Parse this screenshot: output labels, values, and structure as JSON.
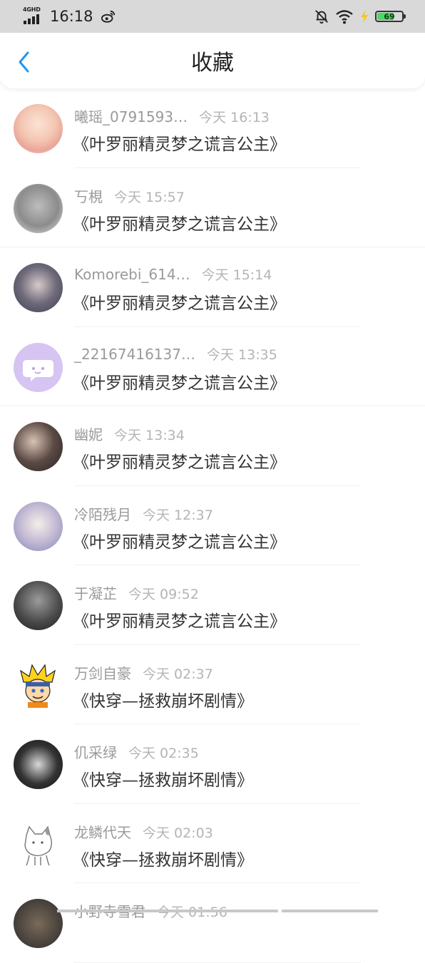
{
  "status_bar": {
    "network": "4GHD",
    "time": "16:18",
    "battery": "69",
    "battery_level": 0.69
  },
  "header": {
    "title": "收藏",
    "back_icon": "chevron-left-icon"
  },
  "items": [
    {
      "username": "曦瑶_0791593…",
      "time": "今天 16:13",
      "title": "《叶罗丽精灵梦之谎言公主》"
    },
    {
      "username": "丂梘",
      "time": "今天 15:57",
      "title": "《叶罗丽精灵梦之谎言公主》"
    },
    {
      "username": "Komorebi_614…",
      "time": "今天 15:14",
      "title": "《叶罗丽精灵梦之谎言公主》"
    },
    {
      "username": "_22167416137…",
      "time": "今天 13:35",
      "title": "《叶罗丽精灵梦之谎言公主》"
    },
    {
      "username": "幽妮",
      "time": "今天 13:34",
      "title": "《叶罗丽精灵梦之谎言公主》"
    },
    {
      "username": "冷陌残月",
      "time": "今天 12:37",
      "title": "《叶罗丽精灵梦之谎言公主》"
    },
    {
      "username": "于凝芷",
      "time": "今天 09:52",
      "title": "《叶罗丽精灵梦之谎言公主》"
    },
    {
      "username": "万剑自豪",
      "time": "今天 02:37",
      "title": "《快穿—拯救崩坏剧情》"
    },
    {
      "username": "仉采绿",
      "time": "今天 02:35",
      "title": "《快穿—拯救崩坏剧情》"
    },
    {
      "username": "龙鳞代天",
      "time": "今天 02:03",
      "title": "《快穿—拯救崩坏剧情》"
    },
    {
      "username": "小野寺雪君",
      "time": "今天 01:56",
      "title": ""
    }
  ]
}
